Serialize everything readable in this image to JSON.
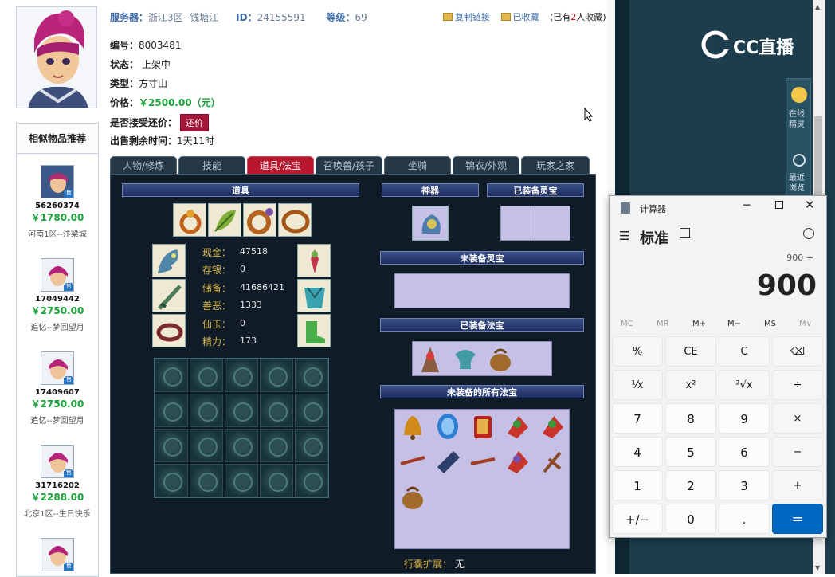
{
  "header": {
    "server_label": "服务器：",
    "server_value": "浙江3区--钱塘江",
    "id_label": "ID：",
    "id_value": "24155591",
    "level_label": "等级：",
    "level_value": "69",
    "copy_link": "复制链接",
    "favorited": "已收藏",
    "fav_count_prefix": "(已有",
    "fav_count": "2",
    "fav_count_suffix": "人收藏)"
  },
  "info": {
    "serial_label": "编号：",
    "serial_value": "8003481",
    "status_label": "状态：",
    "status_value": "上架中",
    "type_label": "类型：",
    "type_value": "方寸山",
    "price_label": "价格：",
    "price_value": "￥2500.00（元）",
    "offer_label": "是否接受还价：",
    "offer_button": "还价",
    "remaining_label": "出售剩余时间：",
    "remaining_value": "1天11时"
  },
  "similar": {
    "title": "相似物品推荐",
    "items": [
      {
        "id": "56260374",
        "price": "￥1780.00",
        "server": "河南1区--汴梁城"
      },
      {
        "id": "17049442",
        "price": "￥2750.00",
        "server": "追忆--梦回望月"
      },
      {
        "id": "17409607",
        "price": "￥2750.00",
        "server": "追忆--梦回望月"
      },
      {
        "id": "31716202",
        "price": "￥2288.00",
        "server": "北京1区--生日快乐"
      },
      {
        "id": "",
        "price": "",
        "server": ""
      }
    ],
    "badge": "售"
  },
  "tabs": [
    "人物/修炼",
    "技能",
    "道具/法宝",
    "召唤兽/孩子",
    "坐骑",
    "锦衣/外观",
    "玩家之家"
  ],
  "active_tab": "道具/法宝",
  "panel": {
    "items_title": "道具",
    "artifact_title": "神器",
    "equipped_spirit_title": "已装备灵宝",
    "unequipped_spirit_title": "未装备灵宝",
    "equipped_treasure_title": "已装备法宝",
    "all_unequipped_title": "未装备的所有法宝",
    "stats": [
      {
        "label": "现金：",
        "value": "47518"
      },
      {
        "label": "存银：",
        "value": "0"
      },
      {
        "label": "储备：",
        "value": "41686421"
      },
      {
        "label": "善恶：",
        "value": "1333"
      },
      {
        "label": "仙玉：",
        "value": "0"
      },
      {
        "label": "精力：",
        "value": "173"
      }
    ],
    "bag_ext_label": "行囊扩展：",
    "bag_ext_value": "无"
  },
  "right": {
    "brand": "CC直播",
    "online_label": "在线精灵",
    "recent_label": "最近浏览"
  },
  "calculator": {
    "title": "计算器",
    "mode": "标准",
    "expression": "900 +",
    "display": "900",
    "memory": [
      "MC",
      "MR",
      "M+",
      "M−",
      "MS",
      "M∨"
    ],
    "keys": [
      [
        "%",
        "CE",
        "C",
        "⌫"
      ],
      [
        "⅟x",
        "x²",
        "²√x",
        "÷"
      ],
      [
        "7",
        "8",
        "9",
        "×"
      ],
      [
        "4",
        "5",
        "6",
        "−"
      ],
      [
        "1",
        "2",
        "3",
        "+"
      ],
      [
        "+/−",
        "0",
        ".",
        "="
      ]
    ]
  }
}
